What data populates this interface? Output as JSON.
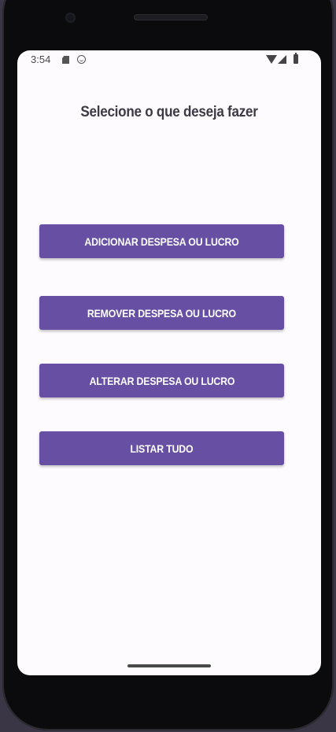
{
  "status_bar": {
    "time": "3:54",
    "icons": [
      "sd-card-icon",
      "smile-icon",
      "wifi-icon",
      "signal-icon",
      "battery-icon"
    ]
  },
  "main": {
    "title": "Selecione o que deseja fazer",
    "buttons": [
      {
        "label": "ADICIONAR DESPESA OU LUCRO"
      },
      {
        "label": "REMOVER DESPESA OU LUCRO"
      },
      {
        "label": "ALTERAR DESPESA OU LUCRO"
      },
      {
        "label": "LISTAR TUDO"
      }
    ]
  },
  "colors": {
    "button": "#6750a4",
    "background": "#fefbfe",
    "title_text": "#3e3a44"
  }
}
